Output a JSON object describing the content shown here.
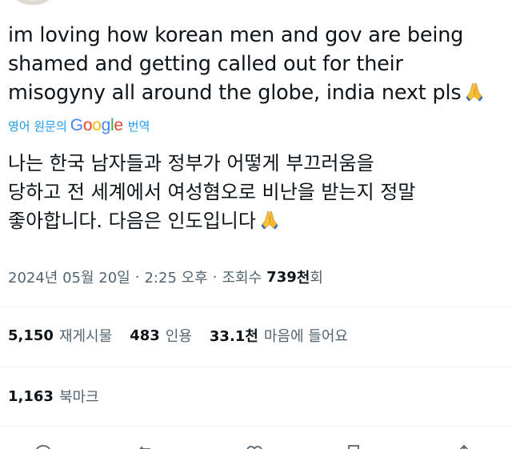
{
  "tweet": {
    "lines": [
      "im loving how korean men and gov are being",
      "shamed and getting called out for their",
      "misogyny all around the globe, india next pls"
    ]
  },
  "translation": {
    "prefix": "영어 원문의",
    "suffix": "번역",
    "google": [
      "G",
      "o",
      "o",
      "g",
      "l",
      "e"
    ],
    "lines": [
      "나는 한국 남자들과 정부가 어떻게 부끄러움을",
      "당하고 전 세계에서 여성혐오로 비난을 받는지 정말",
      "좋아합니다. 다음은 인도입니다"
    ]
  },
  "meta": {
    "date": "2024년 05월 20일",
    "sep": "·",
    "time": "2:25 오후",
    "views_label": "조회수",
    "views_count": "739",
    "views_unit": "천",
    "views_suffix": "회"
  },
  "stats": {
    "reposts_count": "5,150",
    "reposts_label": "재게시물",
    "quotes_count": "483",
    "quotes_label": "인용",
    "likes_count": "33.1천",
    "likes_label": "마음에 들어요",
    "bookmarks_count": "1,163",
    "bookmarks_label": "북마크"
  },
  "icons": {
    "emoji": "folded-hands-icon",
    "actions": [
      "reply-icon",
      "repost-icon",
      "like-icon",
      "bookmark-icon",
      "share-icon"
    ]
  },
  "colors": {
    "text": "#0f1419",
    "secondary": "#536471",
    "link": "#1d9bf0",
    "divider": "#eff3f4"
  }
}
